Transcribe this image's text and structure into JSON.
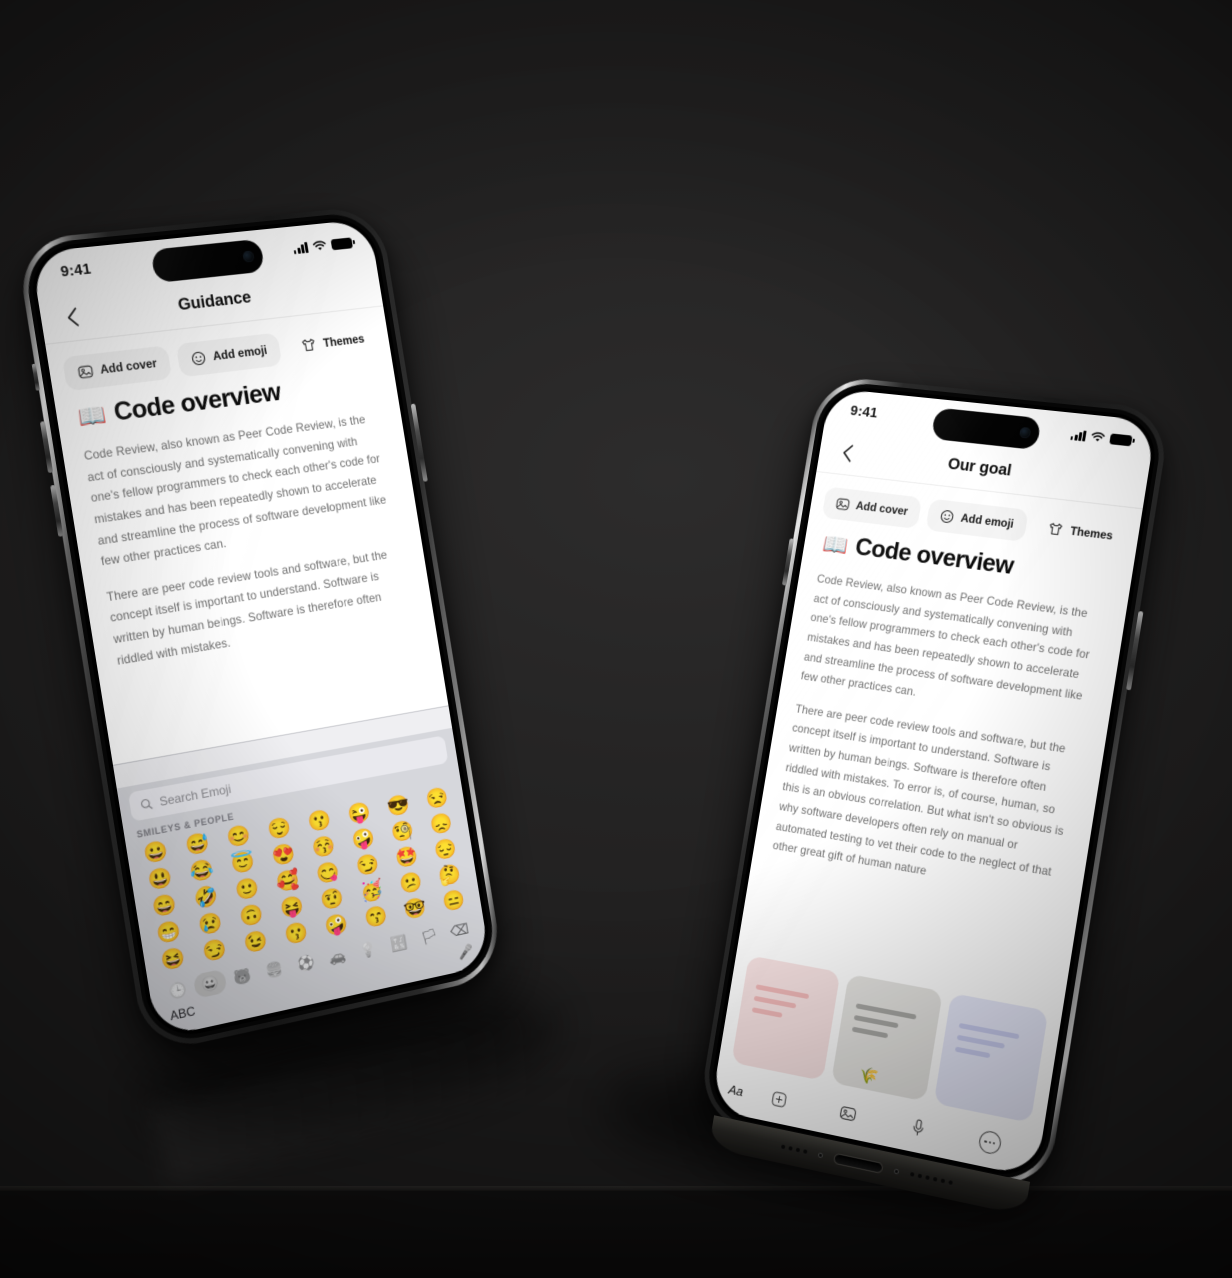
{
  "scene": {
    "background_color": "#222121",
    "floor_color": "#121111"
  },
  "phones": [
    {
      "id": "guidance",
      "statusbar": {
        "time": "9:41",
        "cellular_icon": "cellular-bars-icon",
        "wifi_icon": "wifi-icon",
        "battery_icon": "battery-icon"
      },
      "navbar": {
        "back_icon": "chevron-left-icon",
        "title": "Guidance"
      },
      "chips": [
        {
          "label": "Add cover",
          "icon": "image-icon"
        },
        {
          "label": "Add emoji",
          "icon": "smiley-icon"
        },
        {
          "label": "Themes",
          "icon": "tshirt-icon"
        }
      ],
      "document": {
        "emoji": "📖",
        "title": "Code overview",
        "paragraphs": [
          "Code Review, also known as Peer Code Review, is the act of consciously and systematically convening with one's fellow programmers to check each other's code for mistakes and has been repeatedly shown to accelerate and streamline the process of software development like few other practices can.",
          "There are peer code review tools and software, but the concept itself is important to understand. Software is written by human beings.  Software is therefore often riddled with mistakes."
        ]
      },
      "keyboard": {
        "search_placeholder": "Search Emoji",
        "search_icon": "search-icon",
        "category_header": "SMILEYS & PEOPLE",
        "emojis": [
          "😀",
          "😅",
          "😊",
          "😌",
          "😗",
          "😜",
          "😎",
          "😒",
          "😃",
          "😂",
          "😇",
          "😍",
          "😚",
          "🤪",
          "🧐",
          "😞",
          "😄",
          "🤣",
          "🙂",
          "🥰",
          "😋",
          "😏",
          "🤩",
          "😔",
          "😁",
          "😢",
          "🙃",
          "😝",
          "🤨",
          "🥳",
          "😕",
          "🤔",
          "😆",
          "😏",
          "😉",
          "😗",
          "🤪",
          "😙",
          "🤓",
          "😑"
        ],
        "category_icons": [
          {
            "name": "recents-clock-icon",
            "glyph": "🕒",
            "selected": false
          },
          {
            "name": "smileys-icon",
            "glyph": "😀",
            "selected": true
          },
          {
            "name": "animals-icon",
            "glyph": "🐻",
            "selected": false
          },
          {
            "name": "food-icon",
            "glyph": "🍔",
            "selected": false
          },
          {
            "name": "activity-icon",
            "glyph": "⚽",
            "selected": false
          },
          {
            "name": "travel-icon",
            "glyph": "🚗",
            "selected": false
          },
          {
            "name": "objects-icon",
            "glyph": "💡",
            "selected": false
          },
          {
            "name": "symbols-icon",
            "glyph": "🔣",
            "selected": false
          },
          {
            "name": "flags-icon",
            "glyph": "🏳",
            "selected": false
          },
          {
            "name": "backspace-icon",
            "glyph": "⌫",
            "selected": false
          }
        ],
        "abc_label": "ABC",
        "mic_icon": "microphone-icon"
      }
    },
    {
      "id": "goal",
      "statusbar": {
        "time": "9:41",
        "cellular_icon": "cellular-bars-icon",
        "wifi_icon": "wifi-icon",
        "battery_icon": "battery-icon"
      },
      "navbar": {
        "back_icon": "chevron-left-icon",
        "title": "Our goal"
      },
      "chips": [
        {
          "label": "Add cover",
          "icon": "image-icon"
        },
        {
          "label": "Add emoji",
          "icon": "smiley-icon"
        },
        {
          "label": "Themes",
          "icon": "tshirt-icon"
        }
      ],
      "document": {
        "emoji": "📖",
        "title": "Code overview",
        "paragraphs": [
          "Code Review, also known as Peer Code Review, is the act of consciously and systematically convening with one's fellow programmers to check each other's code for mistakes and has been repeatedly shown to accelerate and streamline the process of software development like few other practices can.",
          "There are peer code review tools and software, but the concept itself is important to understand. Software is written by human beings.  Software is therefore often riddled with mistakes. To error is, of course, human, so this is an obvious correlation. But what isn't so obvious is why software developers often rely on manual or automated testing to vet their code to the neglect of that other great gift of human nature"
        ]
      },
      "cards": [
        {
          "name": "card-pink",
          "color": "#f9e4e4",
          "line_color": "#f1b9b9",
          "line_widths": [
            "78%",
            "62%",
            "44%"
          ]
        },
        {
          "name": "card-gray",
          "color": "#e6e5e2",
          "line_color": "#a8a8a5",
          "line_widths": [
            "86%",
            "64%",
            "52%"
          ],
          "decoration": "🌾"
        },
        {
          "name": "card-blue",
          "color": "#e7e9fa",
          "line_color": "#c8ccef",
          "line_widths": [
            "84%",
            "66%",
            "48%"
          ]
        }
      ],
      "inputbar": {
        "text_format_label": "Aa",
        "add_icon": "plus-square-icon",
        "image_icon": "image-icon",
        "mic_icon": "microphone-icon",
        "more_icon": "ellipsis-icon"
      }
    }
  ]
}
